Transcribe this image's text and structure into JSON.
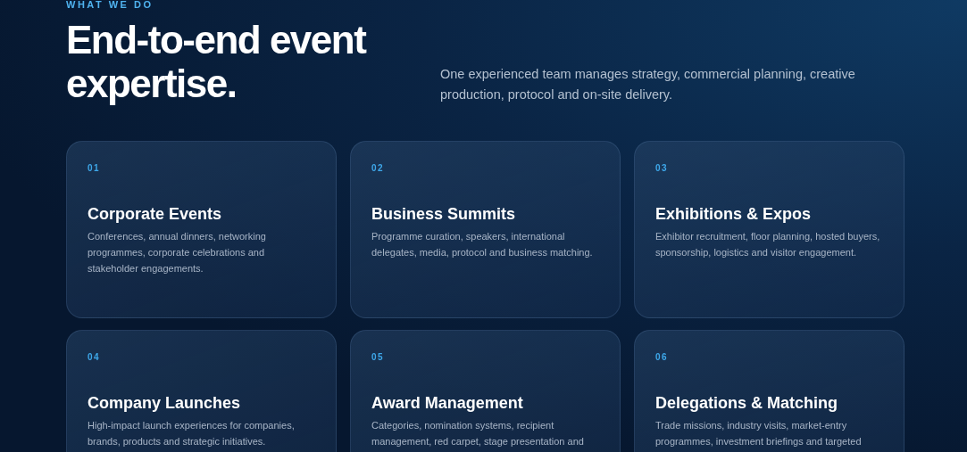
{
  "eyebrow": "WHAT WE DO",
  "heading": "End-to-end event expertise.",
  "intro": "One experienced team manages strategy, commercial planning, creative production, protocol and on-site delivery.",
  "services": [
    {
      "number": "01",
      "title": "Corporate Events",
      "description": "Conferences, annual dinners, networking programmes, corporate celebrations and stakeholder engagements."
    },
    {
      "number": "02",
      "title": "Business Summits",
      "description": "Programme curation, speakers, international delegates, media, protocol and business matching."
    },
    {
      "number": "03",
      "title": "Exhibitions & Expos",
      "description": "Exhibitor recruitment, floor planning, hosted buyers, sponsorship, logistics and visitor engagement."
    },
    {
      "number": "04",
      "title": "Company Launches",
      "description": "High-impact launch experiences for companies, brands, products and strategic initiatives."
    },
    {
      "number": "05",
      "title": "Award Management",
      "description": "Categories, nomination systems, recipient management, red carpet, stage presentation and"
    },
    {
      "number": "06",
      "title": "Delegations & Matching",
      "description": "Trade missions, industry visits, market-entry programmes, investment briefings and targeted"
    }
  ]
}
